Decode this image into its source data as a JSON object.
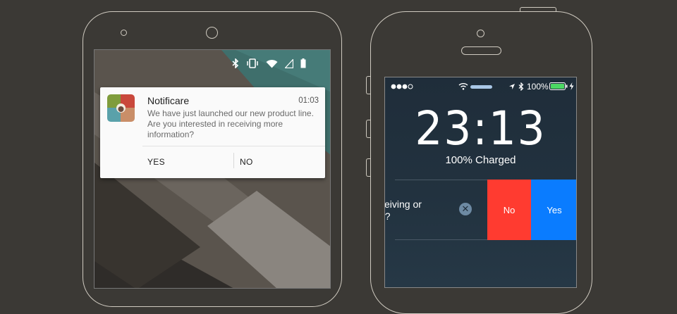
{
  "android": {
    "notification": {
      "app_name": "Notificare",
      "time": "01:03",
      "message": "We have just launched our new product line. Are you interested in receiving more information?",
      "actions": [
        "YES",
        "NO"
      ]
    },
    "status_icons": [
      "bluetooth-icon",
      "vibrate-icon",
      "wifi-icon",
      "signal-icon",
      "battery-icon"
    ]
  },
  "ios": {
    "status": {
      "battery_percent": "100%",
      "icons": [
        "signal-dots-icon",
        "wifi-icon",
        "location-icon",
        "bluetooth-icon",
        "battery-icon",
        "charging-icon"
      ]
    },
    "lock_time": "23:13",
    "charge_status": "100% Charged",
    "notification": {
      "message_fragment": "ceiving or\nn?",
      "actions": [
        "No",
        "Yes"
      ]
    }
  },
  "colors": {
    "background": "#3b3935",
    "ios_no": "#ff3b30",
    "ios_yes": "#0a7cff",
    "ios_battery": "#4cd964"
  }
}
